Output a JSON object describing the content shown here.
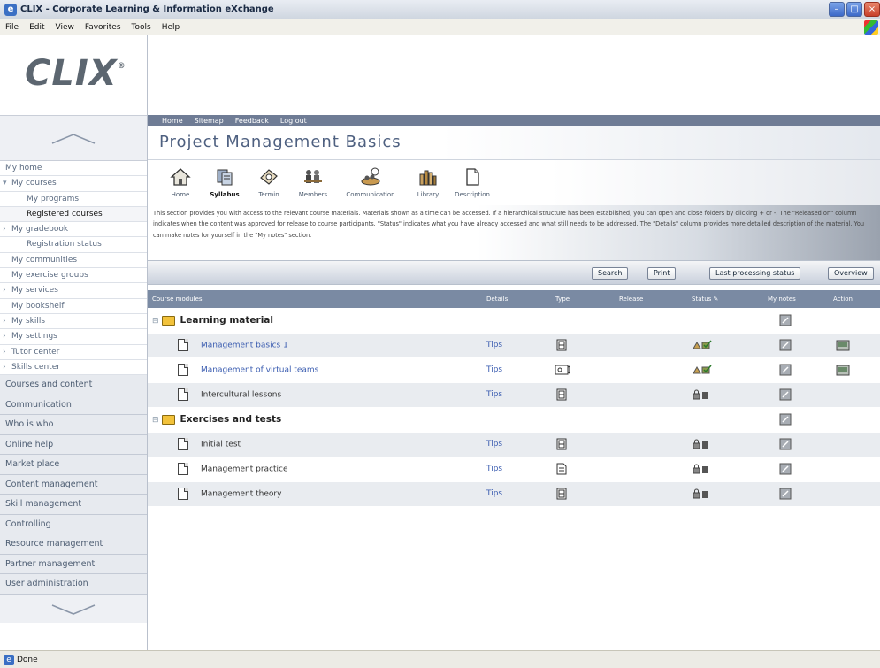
{
  "window": {
    "title": "CLIX - Corporate Learning & Information eXchange"
  },
  "menu": [
    "File",
    "Edit",
    "View",
    "Favorites",
    "Tools",
    "Help"
  ],
  "logo": {
    "text": "CLIX",
    "mark": "®"
  },
  "topnav": [
    "Home",
    "Sitemap",
    "Feedback",
    "Log out"
  ],
  "page_title": "Project Management Basics",
  "tools": [
    {
      "label": "Home",
      "icon": "home-icon"
    },
    {
      "label": "Syllabus",
      "icon": "syllabus-icon",
      "selected": true
    },
    {
      "label": "Termin",
      "icon": "termin-icon"
    },
    {
      "label": "Members",
      "icon": "members-icon"
    },
    {
      "label": "Communication",
      "icon": "communication-icon"
    },
    {
      "label": "Library",
      "icon": "library-icon"
    },
    {
      "label": "Description",
      "icon": "description-icon"
    }
  ],
  "description": "This section provides you with access to the relevant course materials. Materials shown as a time can be accessed. If a hierarchical structure has been established, you can open and close folders by clicking + or -. The \"Released on\" column indicates when the content was approved for release to course participants. \"Status\" indicates what you have already accessed and what still needs to be addressed. The \"Details\" column provides more detailed description of the material. You can make notes for yourself in the \"My notes\" section.",
  "buttons": {
    "search": "Search",
    "print": "Print",
    "last_processing": "Last processing status",
    "overview": "Overview"
  },
  "sidebar": {
    "items": [
      {
        "label": "My home",
        "level": 0
      },
      {
        "label": "My courses",
        "level": 1,
        "chevron": "▾"
      },
      {
        "label": "My programs",
        "level": 2
      },
      {
        "label": "Registered courses",
        "level": 2,
        "active": true
      },
      {
        "label": "My gradebook",
        "level": 1,
        "chevron": "›"
      },
      {
        "label": "Registration status",
        "level": 2
      },
      {
        "label": "My communities",
        "level": 1
      },
      {
        "label": "My exercise groups",
        "level": 1
      },
      {
        "label": "My services",
        "level": 1,
        "chevron": "›"
      },
      {
        "label": "My bookshelf",
        "level": 1
      },
      {
        "label": "My skills",
        "level": 1,
        "chevron": "›"
      },
      {
        "label": "My settings",
        "level": 1,
        "chevron": "›"
      },
      {
        "label": "Tutor center",
        "level": 1,
        "chevron": "›"
      },
      {
        "label": "Skills center",
        "level": 1,
        "chevron": "›"
      }
    ],
    "sections": [
      "Courses and content",
      "Communication",
      "Who is who",
      "Online help",
      "Market place",
      "Content management",
      "Skill management",
      "Controlling",
      "Resource management",
      "Partner management",
      "User administration"
    ]
  },
  "table": {
    "headers": [
      "Course modules",
      "Details",
      "Type",
      "Release",
      "Status",
      "My notes",
      "Action"
    ],
    "rows": [
      {
        "kind": "folder",
        "title": "Learning material"
      },
      {
        "kind": "item",
        "title": "Management basics 1",
        "link": true,
        "details": "Tips",
        "type": "doc",
        "status": "accessed",
        "action": true
      },
      {
        "kind": "item",
        "title": "Management of virtual teams",
        "link": true,
        "details": "Tips",
        "type": "media",
        "status": "accessed",
        "action": true
      },
      {
        "kind": "item",
        "title": "Intercultural lessons",
        "link": false,
        "details": "Tips",
        "type": "doc",
        "status": "locked",
        "action": false
      },
      {
        "kind": "folder",
        "title": "Exercises and tests"
      },
      {
        "kind": "item",
        "title": "Initial test",
        "link": false,
        "details": "Tips",
        "type": "doc",
        "status": "locked",
        "action": false
      },
      {
        "kind": "item",
        "title": "Management practice",
        "link": false,
        "details": "Tips",
        "type": "page",
        "status": "locked",
        "action": false
      },
      {
        "kind": "item",
        "title": "Management theory",
        "link": false,
        "details": "Tips",
        "type": "doc",
        "status": "locked",
        "action": false
      }
    ]
  },
  "statusbar": {
    "text": "Done"
  }
}
